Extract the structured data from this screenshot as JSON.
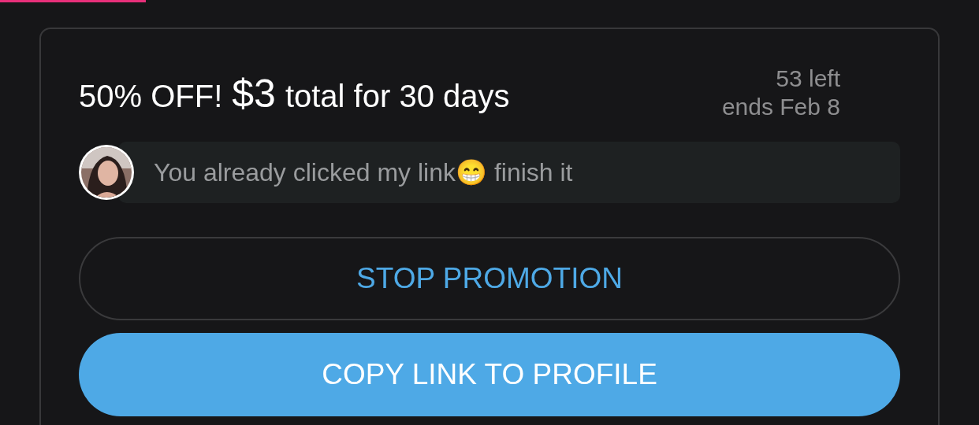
{
  "promotion": {
    "title_prefix": "50% OFF!",
    "price": "$3",
    "title_suffix": "total for 30 days",
    "remaining": "53 left",
    "ends": "ends Feb 8"
  },
  "message": {
    "text": "You already clicked my link😁 finish it"
  },
  "buttons": [
    {
      "label": "STOP PROMOTION",
      "kind": "outline"
    },
    {
      "label": "COPY LINK TO PROFILE",
      "kind": "filled"
    }
  ]
}
